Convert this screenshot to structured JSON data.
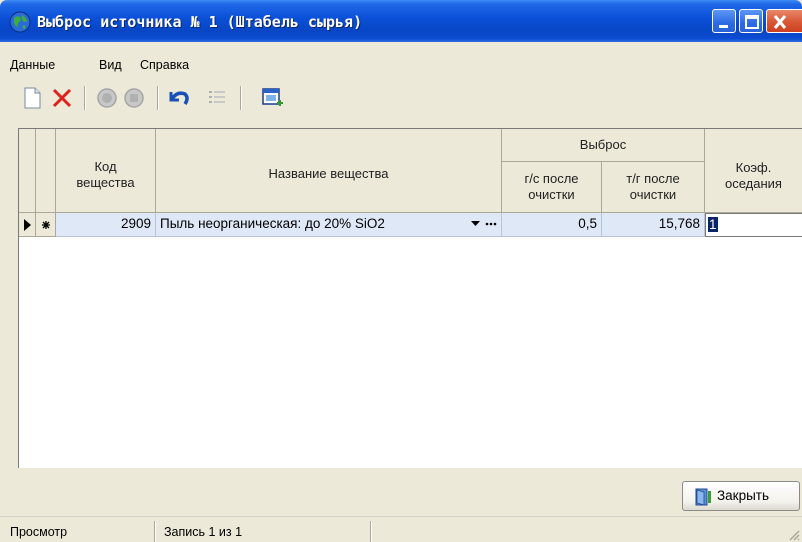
{
  "window": {
    "title": "Выброс источника № 1 (Штабель сырья)"
  },
  "menu": {
    "items": [
      "Данные",
      "Вид",
      "Справка"
    ]
  },
  "toolbar": {
    "buttons": [
      "new-icon",
      "delete-icon",
      "record-icon",
      "stop-icon",
      "undo-icon",
      "list-icon",
      "export-icon"
    ]
  },
  "grid": {
    "headers": {
      "code": "Код вещества",
      "name": "Название вещества",
      "emission_group": "Выброс",
      "gs": "г/с после очистки",
      "tg": "т/г после очистки",
      "coef": "Коэф. оседания"
    },
    "rows": [
      {
        "code": "2909",
        "name": "Пыль неорганическая: до 20% SiO2",
        "gs": "0,5",
        "tg": "15,768",
        "coef": "1"
      }
    ]
  },
  "buttons": {
    "close_label": "Закрыть"
  },
  "status": {
    "mode": "Просмотр",
    "record": "Запись 1 из 1"
  },
  "colors": {
    "titlebar": "#0a4fd6",
    "selected_row": "#dfe8f7",
    "delete_red": "#e0201a"
  }
}
